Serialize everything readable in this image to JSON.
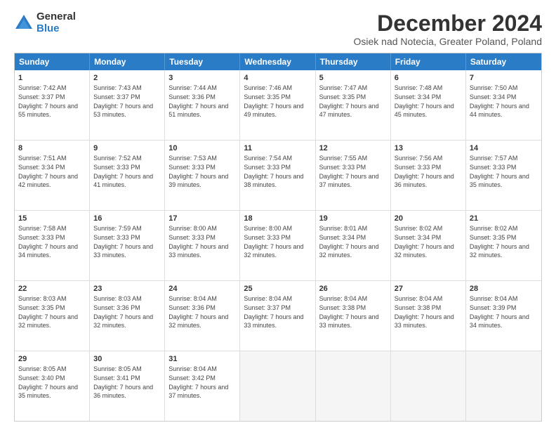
{
  "logo": {
    "general": "General",
    "blue": "Blue"
  },
  "title": "December 2024",
  "subtitle": "Osiek nad Notecia, Greater Poland, Poland",
  "weekdays": [
    "Sunday",
    "Monday",
    "Tuesday",
    "Wednesday",
    "Thursday",
    "Friday",
    "Saturday"
  ],
  "weeks": [
    [
      {
        "day": "1",
        "sunrise": "7:42 AM",
        "sunset": "3:37 PM",
        "daylight": "7 hours and 55 minutes."
      },
      {
        "day": "2",
        "sunrise": "7:43 AM",
        "sunset": "3:37 PM",
        "daylight": "7 hours and 53 minutes."
      },
      {
        "day": "3",
        "sunrise": "7:44 AM",
        "sunset": "3:36 PM",
        "daylight": "7 hours and 51 minutes."
      },
      {
        "day": "4",
        "sunrise": "7:46 AM",
        "sunset": "3:35 PM",
        "daylight": "7 hours and 49 minutes."
      },
      {
        "day": "5",
        "sunrise": "7:47 AM",
        "sunset": "3:35 PM",
        "daylight": "7 hours and 47 minutes."
      },
      {
        "day": "6",
        "sunrise": "7:48 AM",
        "sunset": "3:34 PM",
        "daylight": "7 hours and 45 minutes."
      },
      {
        "day": "7",
        "sunrise": "7:50 AM",
        "sunset": "3:34 PM",
        "daylight": "7 hours and 44 minutes."
      }
    ],
    [
      {
        "day": "8",
        "sunrise": "7:51 AM",
        "sunset": "3:34 PM",
        "daylight": "7 hours and 42 minutes."
      },
      {
        "day": "9",
        "sunrise": "7:52 AM",
        "sunset": "3:33 PM",
        "daylight": "7 hours and 41 minutes."
      },
      {
        "day": "10",
        "sunrise": "7:53 AM",
        "sunset": "3:33 PM",
        "daylight": "7 hours and 39 minutes."
      },
      {
        "day": "11",
        "sunrise": "7:54 AM",
        "sunset": "3:33 PM",
        "daylight": "7 hours and 38 minutes."
      },
      {
        "day": "12",
        "sunrise": "7:55 AM",
        "sunset": "3:33 PM",
        "daylight": "7 hours and 37 minutes."
      },
      {
        "day": "13",
        "sunrise": "7:56 AM",
        "sunset": "3:33 PM",
        "daylight": "7 hours and 36 minutes."
      },
      {
        "day": "14",
        "sunrise": "7:57 AM",
        "sunset": "3:33 PM",
        "daylight": "7 hours and 35 minutes."
      }
    ],
    [
      {
        "day": "15",
        "sunrise": "7:58 AM",
        "sunset": "3:33 PM",
        "daylight": "7 hours and 34 minutes."
      },
      {
        "day": "16",
        "sunrise": "7:59 AM",
        "sunset": "3:33 PM",
        "daylight": "7 hours and 33 minutes."
      },
      {
        "day": "17",
        "sunrise": "8:00 AM",
        "sunset": "3:33 PM",
        "daylight": "7 hours and 33 minutes."
      },
      {
        "day": "18",
        "sunrise": "8:00 AM",
        "sunset": "3:33 PM",
        "daylight": "7 hours and 32 minutes."
      },
      {
        "day": "19",
        "sunrise": "8:01 AM",
        "sunset": "3:34 PM",
        "daylight": "7 hours and 32 minutes."
      },
      {
        "day": "20",
        "sunrise": "8:02 AM",
        "sunset": "3:34 PM",
        "daylight": "7 hours and 32 minutes."
      },
      {
        "day": "21",
        "sunrise": "8:02 AM",
        "sunset": "3:35 PM",
        "daylight": "7 hours and 32 minutes."
      }
    ],
    [
      {
        "day": "22",
        "sunrise": "8:03 AM",
        "sunset": "3:35 PM",
        "daylight": "7 hours and 32 minutes."
      },
      {
        "day": "23",
        "sunrise": "8:03 AM",
        "sunset": "3:36 PM",
        "daylight": "7 hours and 32 minutes."
      },
      {
        "day": "24",
        "sunrise": "8:04 AM",
        "sunset": "3:36 PM",
        "daylight": "7 hours and 32 minutes."
      },
      {
        "day": "25",
        "sunrise": "8:04 AM",
        "sunset": "3:37 PM",
        "daylight": "7 hours and 33 minutes."
      },
      {
        "day": "26",
        "sunrise": "8:04 AM",
        "sunset": "3:38 PM",
        "daylight": "7 hours and 33 minutes."
      },
      {
        "day": "27",
        "sunrise": "8:04 AM",
        "sunset": "3:38 PM",
        "daylight": "7 hours and 33 minutes."
      },
      {
        "day": "28",
        "sunrise": "8:04 AM",
        "sunset": "3:39 PM",
        "daylight": "7 hours and 34 minutes."
      }
    ],
    [
      {
        "day": "29",
        "sunrise": "8:05 AM",
        "sunset": "3:40 PM",
        "daylight": "7 hours and 35 minutes."
      },
      {
        "day": "30",
        "sunrise": "8:05 AM",
        "sunset": "3:41 PM",
        "daylight": "7 hours and 36 minutes."
      },
      {
        "day": "31",
        "sunrise": "8:04 AM",
        "sunset": "3:42 PM",
        "daylight": "7 hours and 37 minutes."
      },
      {
        "day": "",
        "sunrise": "",
        "sunset": "",
        "daylight": ""
      },
      {
        "day": "",
        "sunrise": "",
        "sunset": "",
        "daylight": ""
      },
      {
        "day": "",
        "sunrise": "",
        "sunset": "",
        "daylight": ""
      },
      {
        "day": "",
        "sunrise": "",
        "sunset": "",
        "daylight": ""
      }
    ]
  ]
}
